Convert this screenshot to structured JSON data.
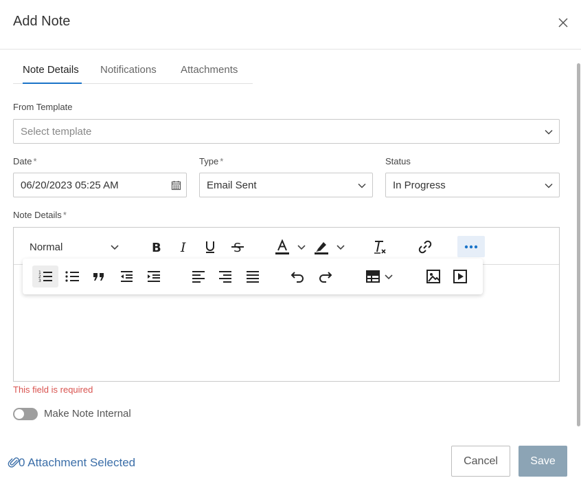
{
  "dialog": {
    "title": "Add Note"
  },
  "tabs": [
    {
      "label": "Note Details",
      "active": true
    },
    {
      "label": "Notifications",
      "active": false
    },
    {
      "label": "Attachments",
      "active": false
    }
  ],
  "form": {
    "template": {
      "label": "From Template",
      "placeholder": "Select template"
    },
    "date": {
      "label": "Date",
      "required": "*",
      "value": "06/20/2023 05:25 AM"
    },
    "type": {
      "label": "Type",
      "required": "*",
      "value": "Email Sent"
    },
    "status": {
      "label": "Status",
      "value": "In Progress"
    },
    "note_details": {
      "label": "Note Details",
      "required": "*"
    }
  },
  "editor": {
    "format_select": "Normal",
    "toolbar": [
      "bold",
      "italic",
      "underline",
      "strikethrough",
      "font-color",
      "highlight",
      "clear-format",
      "link",
      "more"
    ],
    "popup_toolbar": [
      "ordered-list",
      "bullet-list",
      "blockquote",
      "outdent",
      "indent",
      "align-left",
      "align-right",
      "align-justify",
      "undo",
      "redo",
      "table",
      "image",
      "video"
    ]
  },
  "validation": {
    "error": "This field is required"
  },
  "internal_toggle": {
    "label": "Make Note Internal",
    "on": false
  },
  "footer": {
    "attachments": "0 Attachment Selected",
    "cancel": "Cancel",
    "save": "Save"
  },
  "colors": {
    "accent": "#1a73c8",
    "error": "#d9534f",
    "save_bg": "#8ca4b5",
    "link": "#3b6ea8"
  }
}
